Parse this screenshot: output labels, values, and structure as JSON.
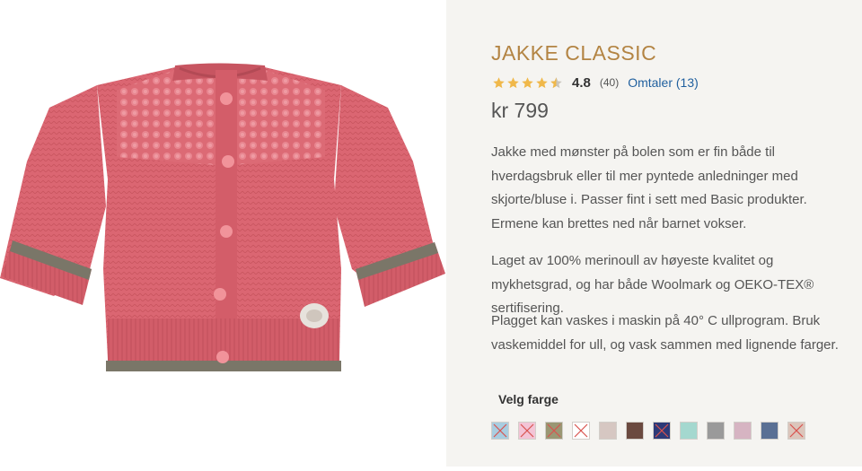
{
  "product": {
    "title": "JAKKE CLASSIC",
    "rating_value": "4.8",
    "rating_fraction": 0.96,
    "rating_count": "(40)",
    "reviews_link": "Omtaler (13)",
    "price": "kr 799",
    "description": [
      "Jakke med mønster på bolen som er fin både til hverdagsbruk eller til mer pyntede anledninger med skjorte/bluse i. Passer fint i sett med Basic produkter. Ermene kan brettes ned når barnet vokser.",
      "Laget av 100% merinoull av høyeste kvalitet og mykhetsgrad, og har både Woolmark og OEKO-TEX® sertifisering.",
      "Plagget kan vaskes i maskin på 40° C ullprogram. Bruk vaskemiddel for ull, og vask sammen med lignende farger."
    ]
  },
  "colors": {
    "title_color": "#b38443",
    "star_color": "#f0b84a",
    "link_color": "#1f5f9e",
    "unavailable_mark": "#d9534f"
  },
  "color_picker": {
    "label": "Velg farge",
    "swatches": [
      {
        "color": "#a9cde0",
        "unavailable": true
      },
      {
        "color": "#f3c4d6",
        "unavailable": true
      },
      {
        "color": "#9a9774",
        "unavailable": true
      },
      {
        "color": "#ffffff",
        "unavailable": true
      },
      {
        "color": "#d6c7c2",
        "unavailable": false
      },
      {
        "color": "#6b4a40",
        "unavailable": false
      },
      {
        "color": "#2d3a78",
        "unavailable": true
      },
      {
        "color": "#a4d8cf",
        "unavailable": false
      },
      {
        "color": "#9a9a9a",
        "unavailable": false
      },
      {
        "color": "#d6b4c2",
        "unavailable": false
      },
      {
        "color": "#5a7094",
        "unavailable": false
      },
      {
        "color": "#dcc5bb",
        "unavailable": true
      }
    ]
  }
}
